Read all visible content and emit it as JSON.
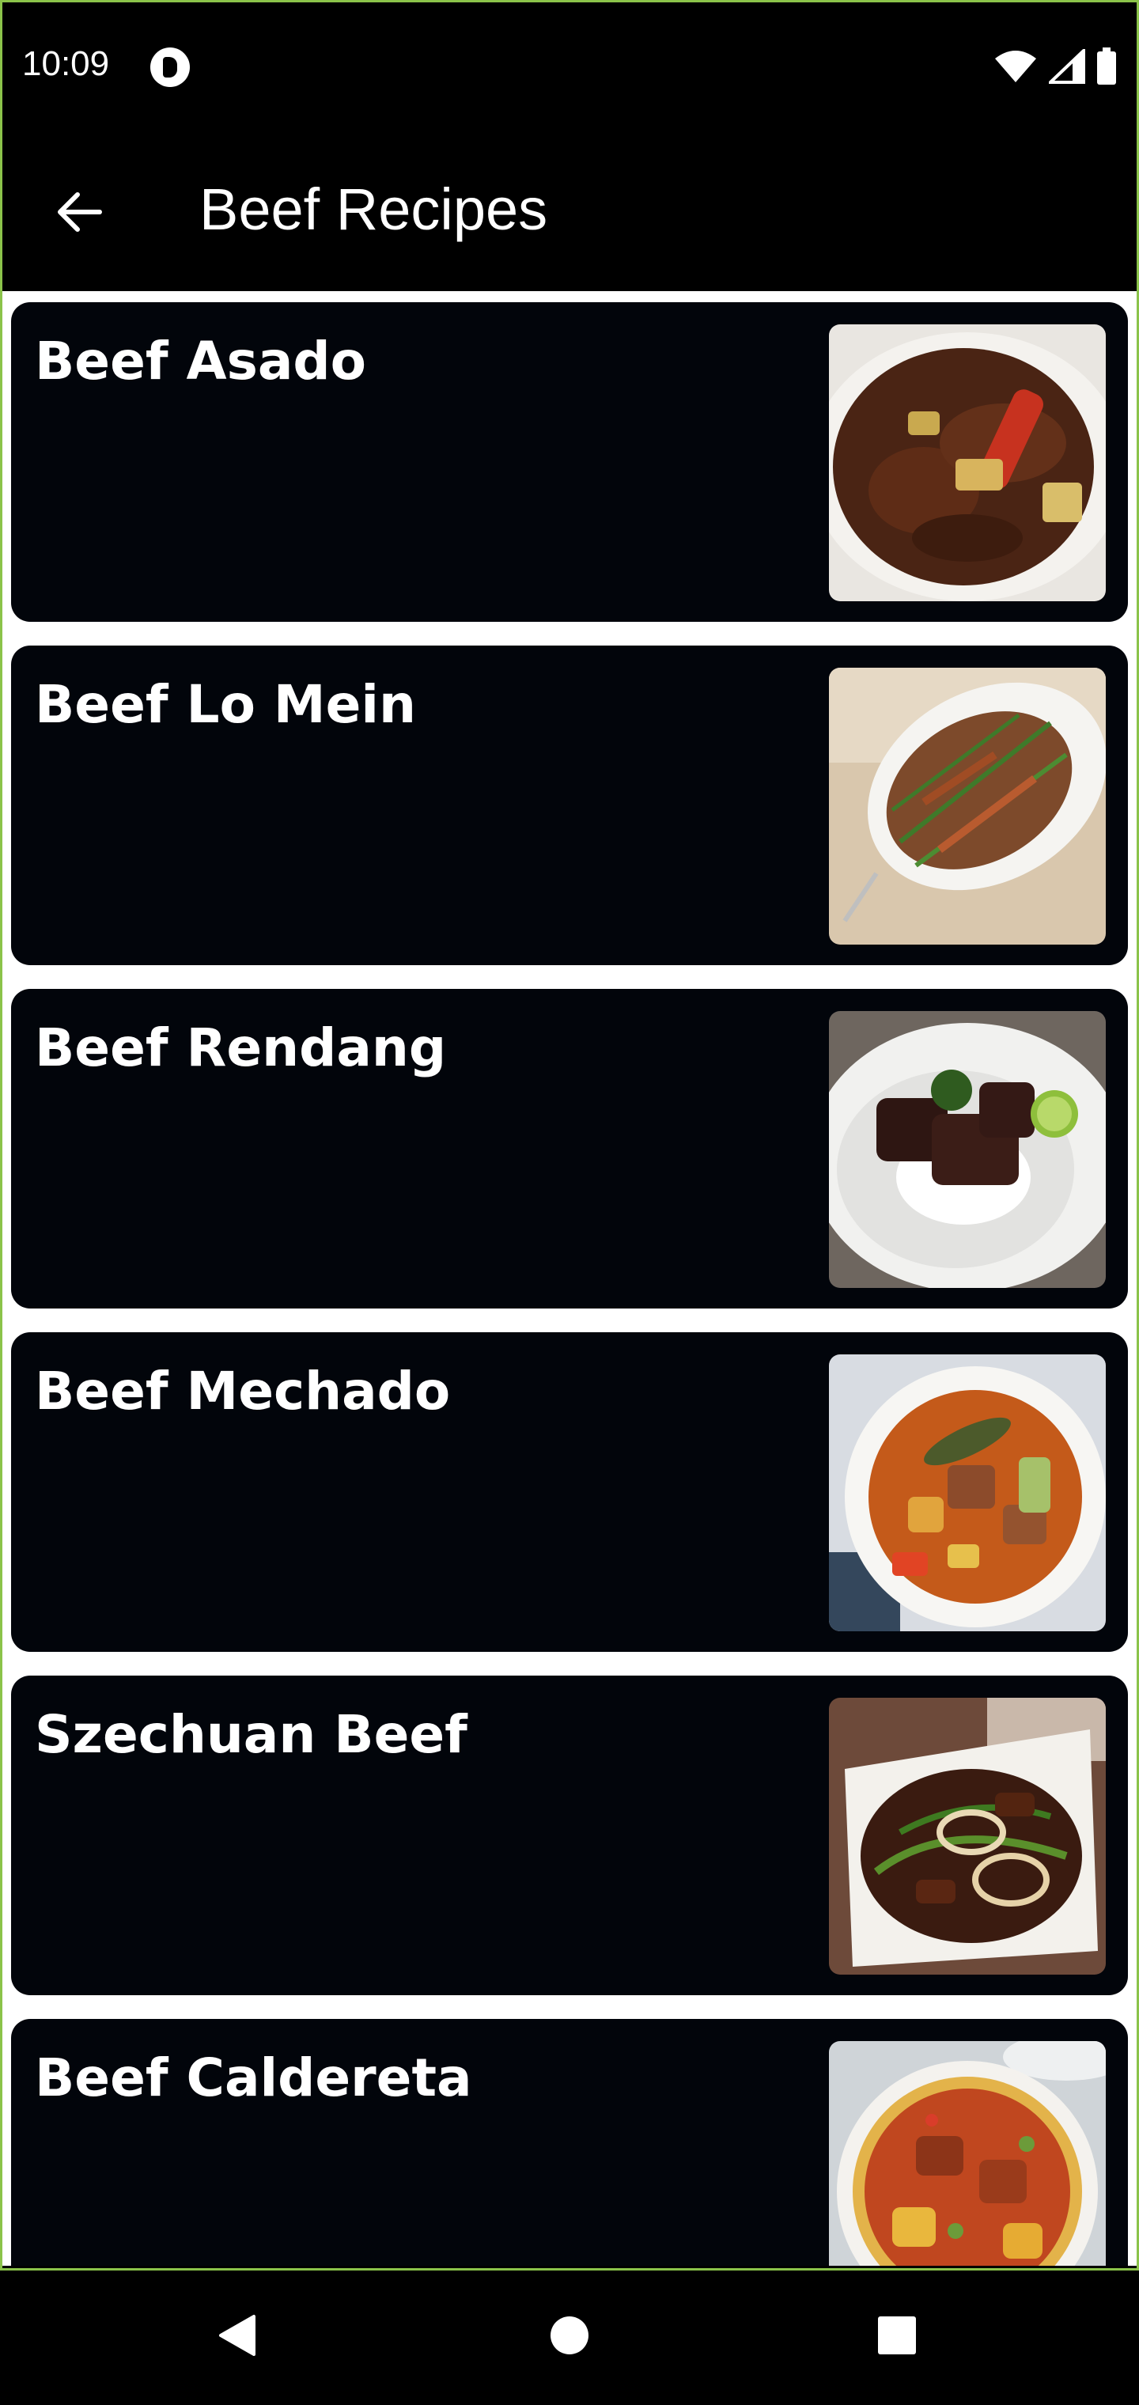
{
  "status_bar": {
    "time": "10:09",
    "icons": [
      "app-notification-icon",
      "wifi-icon",
      "signal-icon",
      "battery-icon"
    ]
  },
  "app_bar": {
    "title": "Beef Recipes",
    "back_icon": "arrow-back-icon"
  },
  "recipes": [
    {
      "name": "Beef Asado",
      "image": "beef-asado-photo"
    },
    {
      "name": "Beef Lo Mein",
      "image": "beef-lo-mein-photo"
    },
    {
      "name": "Beef Rendang",
      "image": "beef-rendang-photo"
    },
    {
      "name": "Beef Mechado",
      "image": "beef-mechado-photo"
    },
    {
      "name": "Szechuan Beef",
      "image": "szechuan-beef-photo"
    },
    {
      "name": "Beef Caldereta",
      "image": "beef-caldereta-photo"
    }
  ],
  "nav_bar": {
    "buttons": [
      "back-triangle-icon",
      "home-circle-icon",
      "recents-square-icon"
    ]
  },
  "colors": {
    "card_background": "#02050b",
    "list_background": "#ffffff",
    "frame_accent": "#8bc34a"
  }
}
